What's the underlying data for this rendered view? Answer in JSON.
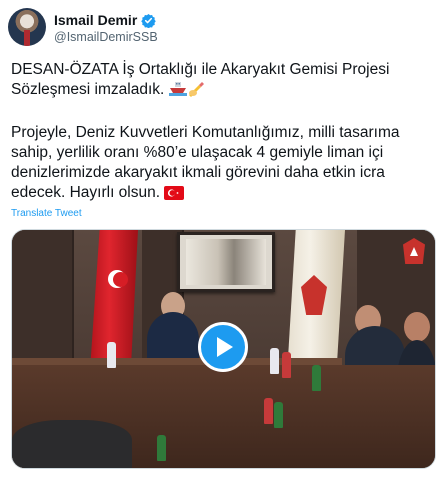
{
  "author": {
    "display_name": "Ismail Demir",
    "handle": "@IsmailDemirSSB",
    "verified_icon": "verified-badge-icon"
  },
  "tweet": {
    "line1": "DESAN-ÖZATA İş Ortaklığı ile Akaryakıt Gemisi Projesi Sözleşmesi imzaladık.",
    "emojis_1": [
      "ship-emoji",
      "writing-hand-emoji"
    ],
    "line2": "Projeyle, Deniz Kuvvetleri Komutanlığımız, milli tasarıma sahip, yerlilik oranı %80’e ulaşacak 4 gemiyle liman içi denizlerimizde akaryakıt ikmali görevini daha etkin icra edecek. Hayırlı olsun.",
    "emojis_2": [
      "turkey-flag-emoji"
    ],
    "translate_label": "Translate Tweet"
  },
  "media": {
    "type": "video",
    "play_icon": "play-icon",
    "logo_icon": "ssb-emblem-icon"
  },
  "colors": {
    "accent": "#1d9bf0",
    "text": "#0f1419",
    "secondary": "#536471"
  }
}
